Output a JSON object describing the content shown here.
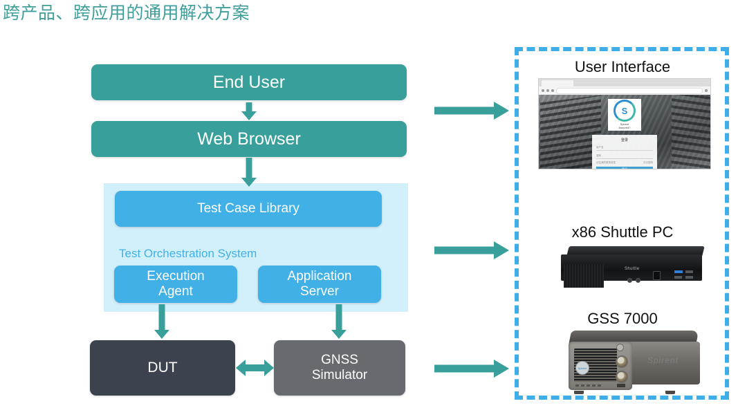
{
  "title": "跨产品、跨应用的通用解决方案",
  "colors": {
    "title": "#3E9E9A",
    "teal": "#389F9B",
    "blue": "#41B0E6",
    "panel_light_blue": "#D2F0FC",
    "dark_slate": "#3C424E",
    "gray": "#676B6F",
    "dashed_border": "#3FAEE8"
  },
  "flow": {
    "end_user": "End User",
    "web_browser": "Web Browser",
    "test_case_library": "Test Case Library",
    "orchestration_label": "Test Orchestration System",
    "execution_agent": "Execution\nAgent",
    "execution_agent_line1": "Execution",
    "execution_agent_line2": "Agent",
    "application_server_line1": "Application",
    "application_server_line2": "Server",
    "dut": "DUT",
    "gnss_simulator_line1": "GNSS",
    "gnss_simulator_line2": "Simulator"
  },
  "deployment": {
    "items": [
      {
        "caption": "User Interface"
      },
      {
        "caption": "x86 Shuttle PC"
      },
      {
        "caption": "GSS 7000"
      }
    ]
  },
  "browser_mock": {
    "login_title": "登录",
    "username_placeholder": "用户名",
    "password_placeholder": "密码",
    "remember_label": "记住我的登录信息",
    "forgot_label": "忘记密码",
    "submit_label": "登录",
    "logo_initial": "S",
    "logo_text_line1": "Spirent",
    "logo_text_line2": "Assured?"
  },
  "hardware": {
    "shuttle_brand": "Shuttle",
    "gss_badge": "Spirent"
  }
}
